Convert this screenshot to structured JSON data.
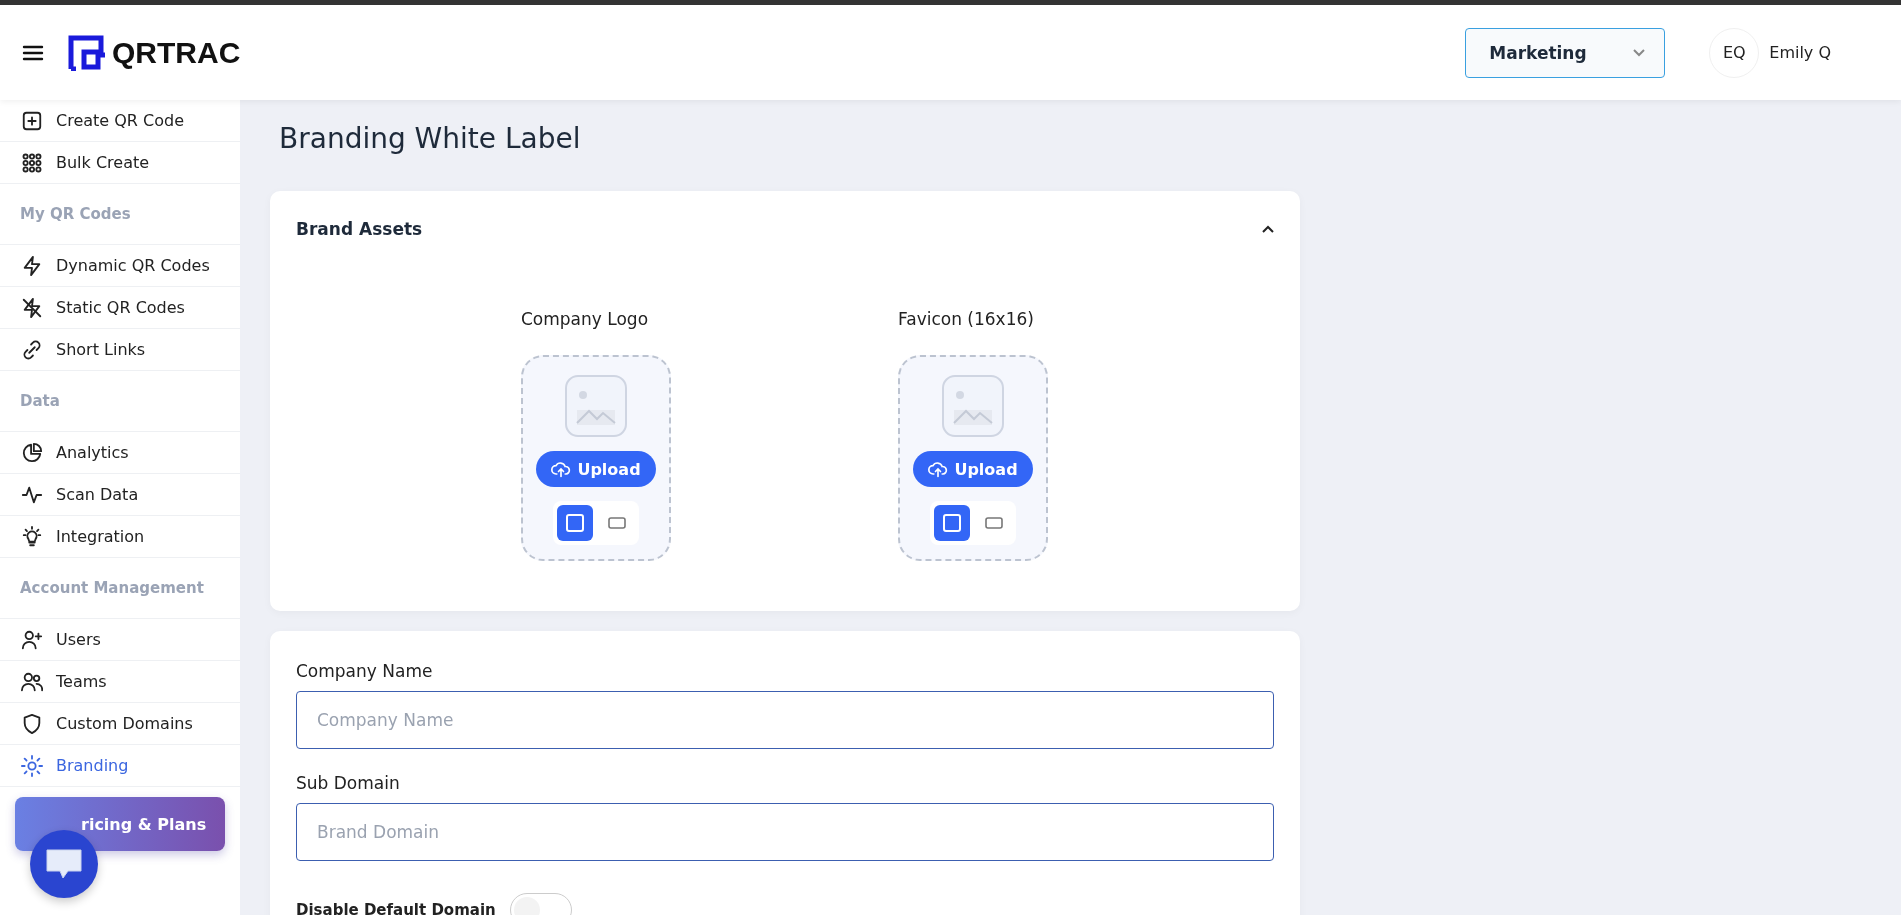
{
  "header": {
    "brand": "QRTRAC",
    "workspace": "Marketing",
    "user": {
      "initials": "EQ",
      "name": "Emily Q"
    }
  },
  "sidebar": {
    "items": [
      {
        "kind": "link",
        "label": "Create QR Code",
        "selected": false
      },
      {
        "kind": "link",
        "label": "Bulk Create",
        "selected": false
      },
      {
        "kind": "heading",
        "label": "My QR Codes"
      },
      {
        "kind": "link",
        "label": "Dynamic QR Codes",
        "selected": false
      },
      {
        "kind": "link",
        "label": "Static QR Codes",
        "selected": false
      },
      {
        "kind": "link",
        "label": "Short Links",
        "selected": false
      },
      {
        "kind": "heading",
        "label": "Data"
      },
      {
        "kind": "link",
        "label": "Analytics",
        "selected": false
      },
      {
        "kind": "link",
        "label": "Scan Data",
        "selected": false
      },
      {
        "kind": "link",
        "label": "Integration",
        "selected": false
      },
      {
        "kind": "heading",
        "label": "Account Management"
      },
      {
        "kind": "link",
        "label": "Users",
        "selected": false
      },
      {
        "kind": "link",
        "label": "Teams",
        "selected": false
      },
      {
        "kind": "link",
        "label": "Custom Domains",
        "selected": false
      },
      {
        "kind": "link",
        "label": "Branding",
        "selected": true
      }
    ],
    "promo": "ricing & Plans"
  },
  "page_title": "Branding White Label",
  "brand_assets": {
    "title": "Brand Assets",
    "expanded": true,
    "uploads": [
      {
        "label": "Company Logo",
        "button": "Upload",
        "shapes": [
          {
            "kind": "square",
            "selected": true
          },
          {
            "kind": "wide",
            "selected": false
          }
        ]
      },
      {
        "label": "Favicon (16x16)",
        "button": "Upload",
        "shapes": [
          {
            "kind": "square",
            "selected": true
          },
          {
            "kind": "wide",
            "selected": false
          }
        ]
      }
    ]
  },
  "form": {
    "fields": [
      {
        "label": "Company Name",
        "placeholder": "Company Name"
      },
      {
        "label": "Sub Domain",
        "placeholder": "Brand Domain"
      }
    ],
    "toggle": {
      "label": "Disable Default Domain",
      "on": false
    }
  }
}
